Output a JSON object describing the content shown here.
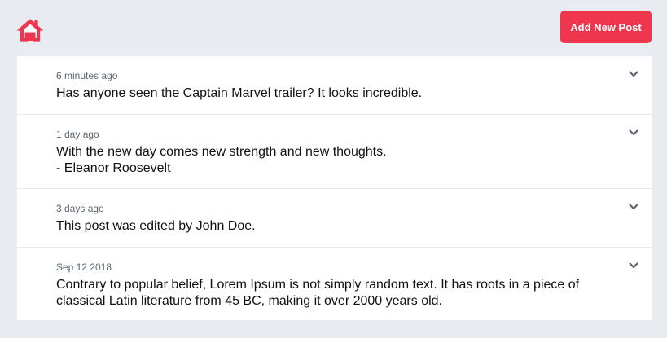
{
  "header": {
    "home_icon": "home-icon",
    "add_button_label": "Add New Post",
    "accent_color": "#f0364f"
  },
  "posts": [
    {
      "time": "6 minutes ago",
      "text": "Has anyone seen the Captain Marvel trailer? It looks incredible.",
      "menu_icon": "chevron-down-icon"
    },
    {
      "time": "1 day ago",
      "text": "With the new day comes new strength and new thoughts.\n- Eleanor Roosevelt",
      "menu_icon": "chevron-down-icon"
    },
    {
      "time": "3 days ago",
      "text": "This post was edited by John Doe.",
      "menu_icon": "chevron-down-icon"
    },
    {
      "time": "Sep 12 2018",
      "text": "Contrary to popular belief, Lorem Ipsum is not simply random text. It has roots in a piece of classical Latin literature from 45 BC, making it over 2000 years old.",
      "menu_icon": "chevron-down-icon"
    }
  ]
}
